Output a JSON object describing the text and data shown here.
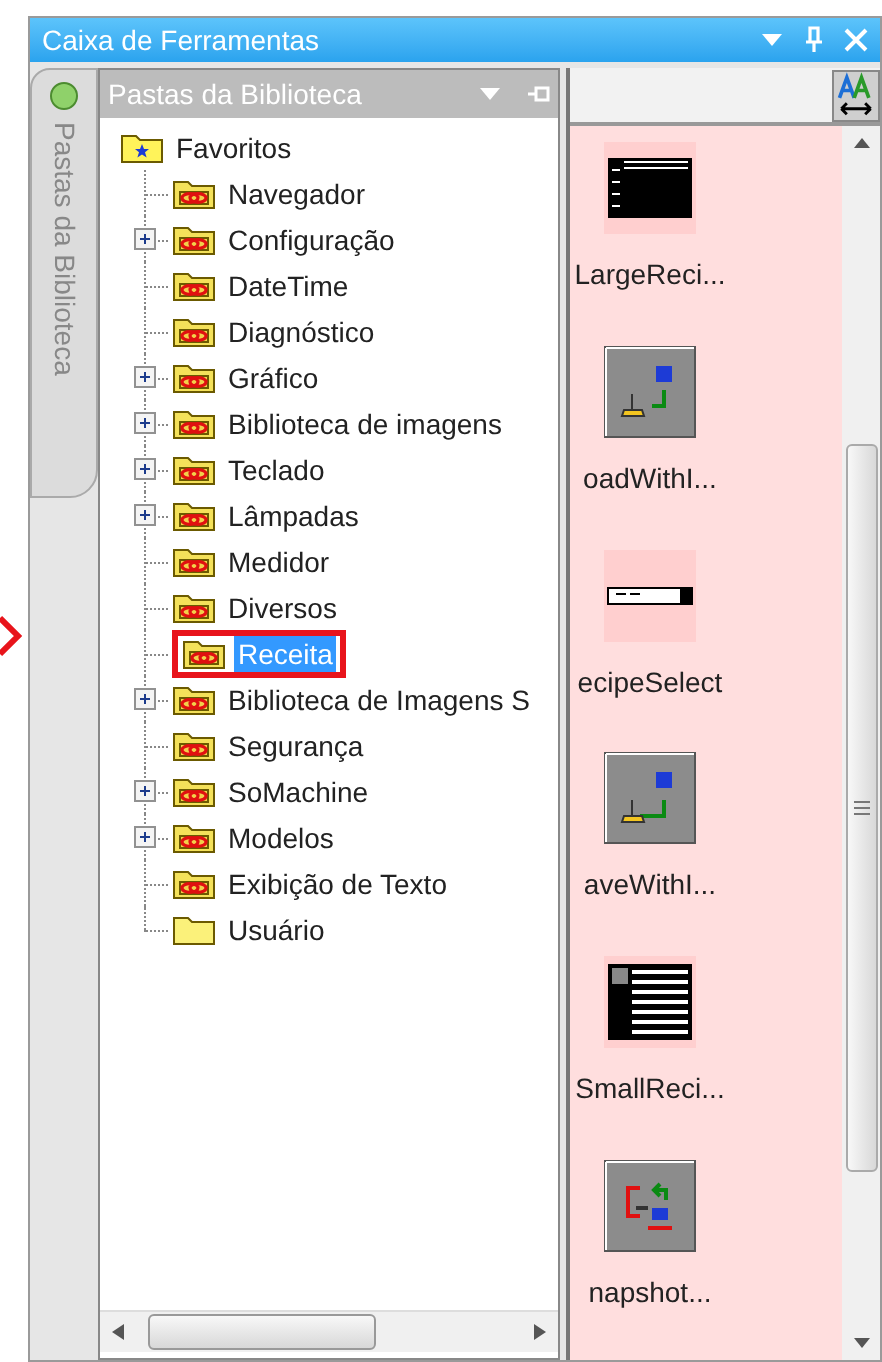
{
  "window": {
    "title": "Caixa de Ferramentas"
  },
  "side_tab": {
    "label": "Pastas da Biblioteca"
  },
  "library_panel": {
    "title": "Pastas da Biblioteca",
    "tree": [
      {
        "label": "Favoritos",
        "kind": "favorites",
        "expandable": false,
        "selected": false,
        "callout": false,
        "children": [
          {
            "label": "Navegador",
            "kind": "library",
            "expandable": false,
            "selected": false,
            "callout": false
          },
          {
            "label": "Configuração",
            "kind": "library",
            "expandable": true,
            "selected": false,
            "callout": false
          },
          {
            "label": "DateTime",
            "kind": "library",
            "expandable": false,
            "selected": false,
            "callout": false
          },
          {
            "label": "Diagnóstico",
            "kind": "library",
            "expandable": false,
            "selected": false,
            "callout": false
          },
          {
            "label": "Gráfico",
            "kind": "library",
            "expandable": true,
            "selected": false,
            "callout": false
          },
          {
            "label": "Biblioteca de imagens",
            "kind": "library",
            "expandable": true,
            "selected": false,
            "callout": false
          },
          {
            "label": "Teclado",
            "kind": "library",
            "expandable": true,
            "selected": false,
            "callout": false
          },
          {
            "label": "Lâmpadas",
            "kind": "library",
            "expandable": true,
            "selected": false,
            "callout": false
          },
          {
            "label": "Medidor",
            "kind": "library",
            "expandable": false,
            "selected": false,
            "callout": false
          },
          {
            "label": "Diversos",
            "kind": "library",
            "expandable": false,
            "selected": false,
            "callout": false
          },
          {
            "label": "Receita",
            "kind": "library",
            "expandable": false,
            "selected": true,
            "callout": true
          },
          {
            "label": "Biblioteca de Imagens S",
            "kind": "library",
            "expandable": true,
            "selected": false,
            "callout": false
          },
          {
            "label": "Segurança",
            "kind": "library",
            "expandable": false,
            "selected": false,
            "callout": false
          },
          {
            "label": "SoMachine",
            "kind": "library",
            "expandable": true,
            "selected": false,
            "callout": false
          },
          {
            "label": "Modelos",
            "kind": "library",
            "expandable": true,
            "selected": false,
            "callout": false
          },
          {
            "label": "Exibição de Texto",
            "kind": "library",
            "expandable": false,
            "selected": false,
            "callout": false
          },
          {
            "label": "Usuário",
            "kind": "user",
            "expandable": false,
            "selected": false,
            "callout": false
          }
        ]
      }
    ]
  },
  "objects": [
    {
      "label": "LargeReci...",
      "kind": "large_table"
    },
    {
      "label": "oadWithI...",
      "kind": "load"
    },
    {
      "label": "ecipeSelect",
      "kind": "selector"
    },
    {
      "label": "aveWithI...",
      "kind": "save"
    },
    {
      "label": "SmallReci...",
      "kind": "small_table"
    },
    {
      "label": "napshot...",
      "kind": "snapshot"
    }
  ]
}
